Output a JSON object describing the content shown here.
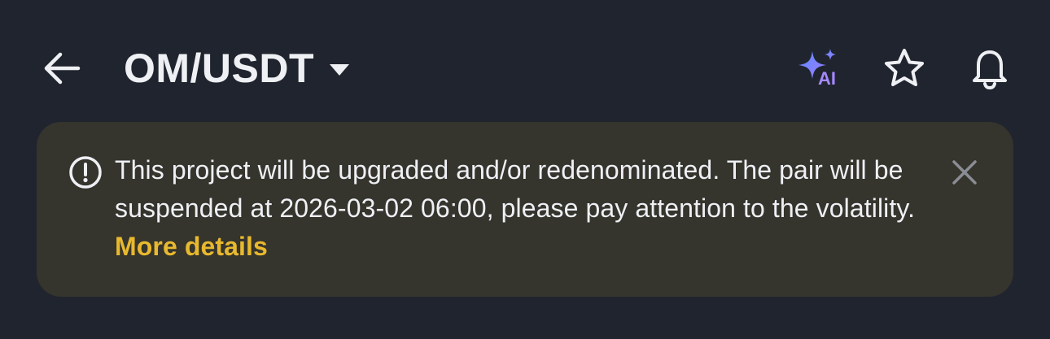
{
  "header": {
    "back_icon": "arrow-left-icon",
    "pair": "OM/USDT",
    "dropdown_icon": "caret-down-icon",
    "actions": [
      {
        "icon": "ai-sparkle-icon",
        "label": "AI"
      },
      {
        "icon": "star-icon"
      },
      {
        "icon": "bell-icon"
      }
    ]
  },
  "notice": {
    "icon": "info-circle-icon",
    "message": "This project will be upgraded and/or redenominated. The pair will be suspended at 2026-03-02 06:00, please pay attention to the volatility.",
    "link_text": "More details",
    "close_icon": "close-icon"
  },
  "colors": {
    "background": "#20242e",
    "notice_background": "#35342d",
    "text": "#eef0f4",
    "link": "#e8b92e",
    "ai_gradient_start": "#5f8bff",
    "ai_gradient_end": "#9b7bff"
  }
}
